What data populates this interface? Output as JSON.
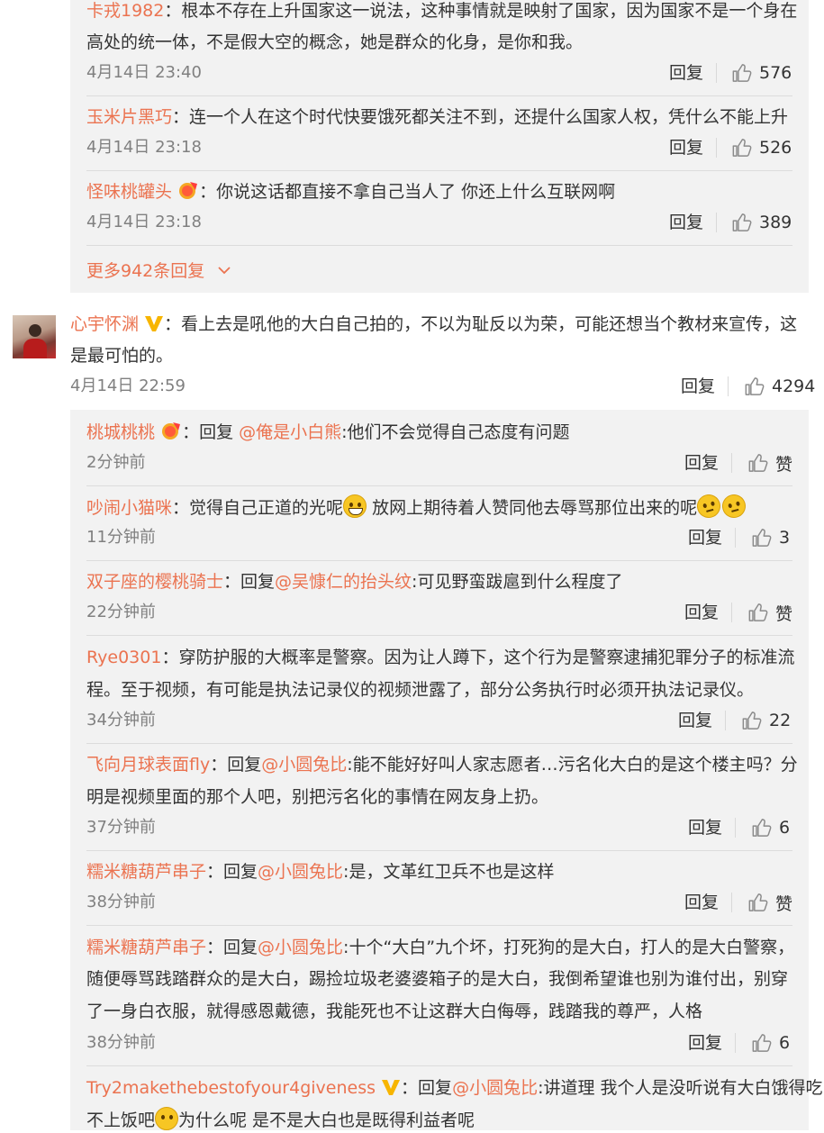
{
  "top_thread": {
    "replies": [
      {
        "user": "卡戎1982",
        "lines": [
          "：根本不存在上升国家这一说法，这种事情就是映射了国家，因为国家不是一个身在",
          "高处的统一体，不是假大空的概念，她是群众的化身，是你和我。"
        ],
        "time": "4月14日 23:40",
        "reply": "回复",
        "likes": "576"
      },
      {
        "user": "玉米片黑巧",
        "lines": [
          "：连一个人在这个时代快要饿死都关注不到，还提什么国家人权，凭什么不能上升"
        ],
        "time": "4月14日 23:18",
        "reply": "回复",
        "likes": "526"
      },
      {
        "user": "怪味桃罐头",
        "lines": [
          "：你说这话都直接不拿自己当人了 你还上什么互联网啊"
        ],
        "time": "4月14日 23:18",
        "reply": "回复",
        "likes": "389"
      }
    ],
    "more_label": "更多942条回复"
  },
  "main_comment": {
    "user": "心宇怀渊",
    "lines": [
      "：看上去是吼他的大白自己拍的，不以为耻反以为荣，可能还想当个教材来宣传，这",
      "是最可怕的。"
    ],
    "time": "4月14日 22:59",
    "reply": "回复",
    "likes": "4294"
  },
  "replies": [
    {
      "user": "桃城桃桃",
      "p1": "：回复 ",
      "mention": "@俺是小白熊",
      "p2": ":他们不会觉得自己态度有问题",
      "time": "2分钟前",
      "reply": "回复",
      "likes": "赞"
    },
    {
      "user": "吵闹小猫咪",
      "p1": "：觉得自己正道的光呢",
      "p2": " 放网上期待着人赞同他去辱骂那位出来的呢",
      "time": "11分钟前",
      "reply": "回复",
      "likes": "3"
    },
    {
      "user": "双子座的樱桃骑士",
      "p1": "：回复",
      "mention": "@吴慷仁的抬头纹",
      "p2": ":可见野蛮跋扈到什么程度了",
      "time": "22分钟前",
      "reply": "回复",
      "likes": "赞"
    },
    {
      "user": "Rye0301",
      "p1": "：穿防护服的大概率是警察。因为让人蹲下，这个行为是警察逮捕犯罪分子的标准流",
      "l2": "程。至于视频，有可能是执法记录仪的视频泄露了，部分公务执行时必须开执法记录仪。",
      "time": "34分钟前",
      "reply": "回复",
      "likes": "22"
    },
    {
      "user": "飞向月球表面fly",
      "p1": "：回复",
      "mention": "@小圆兔比",
      "p2": ":能不能好好叫人家志愿者…污名化大白的是这个楼主吗？分",
      "l2": "明是视频里面的那个人吧，别把污名化的事情在网友身上扔。",
      "time": "37分钟前",
      "reply": "回复",
      "likes": "6"
    },
    {
      "user": "糯米糖葫芦串子",
      "p1": "：回复",
      "mention": "@小圆兔比",
      "p2": ":是，文革红卫兵不也是这样",
      "time": "38分钟前",
      "reply": "回复",
      "likes": "赞"
    },
    {
      "user": "糯米糖葫芦串子",
      "p1": "：回复",
      "mention": "@小圆兔比",
      "p2": ":十个“大白”九个坏，打死狗的是大白，打人的是大白警察，",
      "l2": "随便辱骂践踏群众的是大白，踢捡垃圾老婆婆箱子的是大白，我倒希望谁也别为谁付出，别穿",
      "l3": "了一身白衣服，就得感恩戴德，我能死也不让这群大白侮辱，践踏我的尊严，人格",
      "time": "38分钟前",
      "reply": "回复",
      "likes": "6"
    },
    {
      "user": "Try2makethebestofyour4giveness",
      "p1": "：回复",
      "mention": "@小圆兔比",
      "p2": ":讲道理 我个人是没听说有大白饿得吃",
      "l2a": "不上饭吧",
      "l2b": "为什么呢 是不是大白也是既得利益者呢"
    }
  ]
}
